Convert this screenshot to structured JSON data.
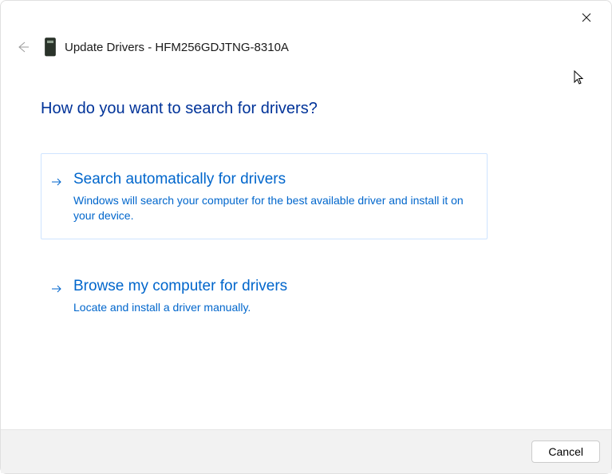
{
  "header": {
    "title_prefix": "Update Drivers - ",
    "device_name": "HFM256GDJTNG-8310A"
  },
  "main": {
    "heading": "How do you want to search for drivers?"
  },
  "options": [
    {
      "title": "Search automatically for drivers",
      "description": "Windows will search your computer for the best available driver and install it on your device."
    },
    {
      "title": "Browse my computer for drivers",
      "description": "Locate and install a driver manually."
    }
  ],
  "footer": {
    "cancel_label": "Cancel"
  }
}
